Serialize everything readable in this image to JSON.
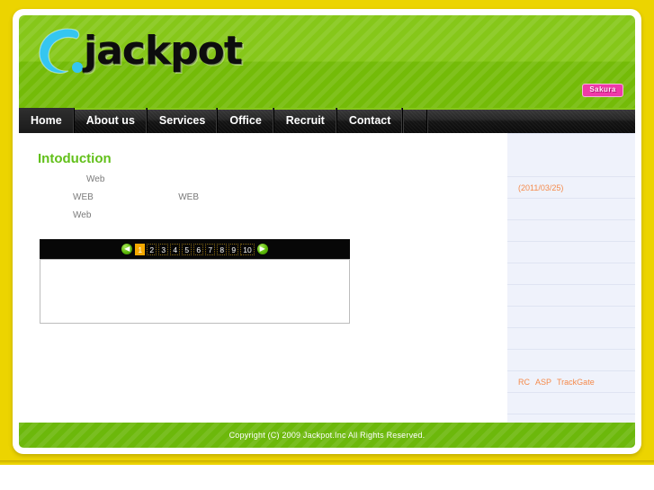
{
  "site": {
    "logo_text": "jackpot",
    "badge_label": "Sakura"
  },
  "nav": {
    "items": [
      {
        "label": "Home",
        "active": true
      },
      {
        "label": "About us",
        "active": false
      },
      {
        "label": "Services",
        "active": false
      },
      {
        "label": "Office",
        "active": false
      },
      {
        "label": "Recruit",
        "active": false
      },
      {
        "label": "Contact",
        "active": false
      }
    ]
  },
  "main": {
    "page_title": "Intoduction",
    "lines": [
      "Web",
      "WEB                                  WEB",
      "Web"
    ],
    "pagination": {
      "prev_icon": "arrow-left-icon",
      "next_icon": "arrow-right-icon",
      "pages": [
        "1",
        "2",
        "3",
        "4",
        "5",
        "6",
        "7",
        "8",
        "9",
        "10"
      ],
      "active_page": "1"
    },
    "content_box_text": ""
  },
  "sidebar": {
    "rows": [
      {
        "type": "blank",
        "text": ""
      },
      {
        "type": "blank",
        "text": ""
      },
      {
        "type": "date",
        "text": "(2011/03/25)"
      },
      {
        "type": "blank",
        "text": ""
      },
      {
        "type": "blank",
        "text": ""
      },
      {
        "type": "blank",
        "text": ""
      },
      {
        "type": "blank",
        "text": ""
      },
      {
        "type": "blank",
        "text": ""
      },
      {
        "type": "blank",
        "text": ""
      },
      {
        "type": "blank",
        "text": ""
      },
      {
        "type": "blank",
        "text": ""
      },
      {
        "type": "links",
        "links": [
          "RC",
          "ASP",
          "TrackGate"
        ]
      },
      {
        "type": "blank",
        "text": ""
      }
    ]
  },
  "footer": {
    "copyright": "Copyright (C) 2009 Jackpot.Inc All Rights Reserved."
  },
  "colors": {
    "page_background": "#ecd400",
    "header_green_light": "#86c719",
    "header_green_dark": "#74bb08",
    "footer_green": "#6cb80b",
    "nav_black": "#141414",
    "title_green": "#62c01a",
    "accent_orange": "#f5a800",
    "sidebar_text_orange": "#f58a4b",
    "sidebar_background": "#eff2fb",
    "badge_pink": "#ee3aa8",
    "logo_cyan": "#35c6f0"
  }
}
